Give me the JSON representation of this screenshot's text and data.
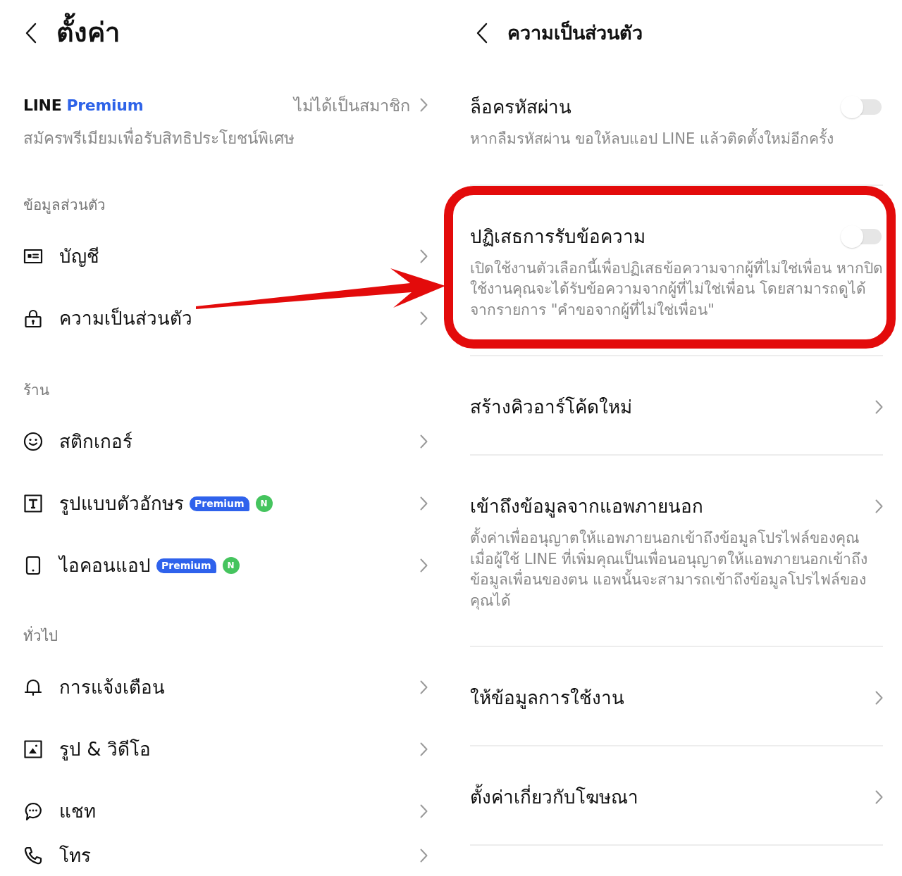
{
  "settings_screen": {
    "title": "ตั้งค่า",
    "premium": {
      "logo_word": "LINE",
      "logo_tier": "Premium",
      "status": "ไม่ได้เป็นสมาชิก",
      "description": "สมัครพรีเมียมเพื่อรับสิทธิประโยชน์พิเศษ"
    },
    "sections": [
      {
        "heading": "ข้อมูลส่วนตัว",
        "items": [
          {
            "label": "บัญชี",
            "highlighted": false
          },
          {
            "label": "ความเป็นส่วนตัว",
            "highlighted": true
          }
        ]
      },
      {
        "heading": "ร้าน",
        "items": [
          {
            "label": "สติกเกอร์",
            "highlighted": false
          },
          {
            "label": "รูปแบบตัวอักษร",
            "highlighted": false,
            "badges": [
              {
                "kind": "premium",
                "text": "Premium"
              },
              {
                "kind": "new",
                "text": "N"
              }
            ]
          },
          {
            "label": "ไอคอนแอป",
            "highlighted": false,
            "badges": [
              {
                "kind": "premium",
                "text": "Premium"
              },
              {
                "kind": "new",
                "text": "N"
              }
            ]
          }
        ]
      },
      {
        "heading": "ทั่วไป",
        "items": [
          {
            "label": "การแจ้งเตือน",
            "highlighted": false
          },
          {
            "label": "รูป & วิดีโอ",
            "highlighted": false
          },
          {
            "label": "แชท",
            "highlighted": false
          },
          {
            "label": "โทร",
            "highlighted": false
          }
        ]
      }
    ]
  },
  "privacy_screen": {
    "title": "ความเป็นส่วนตัว",
    "items": [
      {
        "kind": "toggle",
        "label": "ล็อครหัสผ่าน",
        "on": false,
        "highlighted": false,
        "description": "หากลืมรหัสผ่าน ขอให้ลบแอป LINE แล้วติดตั้งใหม่อีกครั้ง"
      },
      {
        "kind": "toggle",
        "label": "ปฏิเสธการรับข้อความ",
        "on": false,
        "highlighted": true,
        "description": "เปิดใช้งานตัวเลือกนี้เพื่อปฏิเสธข้อความจากผู้ที่ไม่ใช่เพื่อน หากปิดใช้งานคุณจะได้รับข้อความจากผู้ที่ไม่ใช่เพื่อน โดยสามารถดูได้จากรายการ \"คำขอจากผู้ที่ไม่ใช่เพื่อน\""
      },
      {
        "kind": "link",
        "label": "สร้างคิวอาร์โค้ดใหม่",
        "highlighted": false
      },
      {
        "kind": "link",
        "label": "เข้าถึงข้อมูลจากแอพภายนอก",
        "highlighted": false,
        "description": "ตั้งค่าเพื่ออนุญาตให้แอพภายนอกเข้าถึงข้อมูลโปรไฟล์ของคุณ เมื่อผู้ใช้ LINE ที่เพิ่มคุณเป็นเพื่อนอนุญาตให้แอพภายนอกเข้าถึงข้อมูลเพื่อนของตน แอพนั้นจะสามารถเข้าถึงข้อมูลโปรไฟล์ของคุณได้"
      },
      {
        "kind": "link",
        "label": "ให้ข้อมูลการใช้งาน",
        "highlighted": false
      },
      {
        "kind": "link",
        "label": "ตั้งค่าเกี่ยวกับโฆษณา",
        "highlighted": false
      }
    ]
  }
}
